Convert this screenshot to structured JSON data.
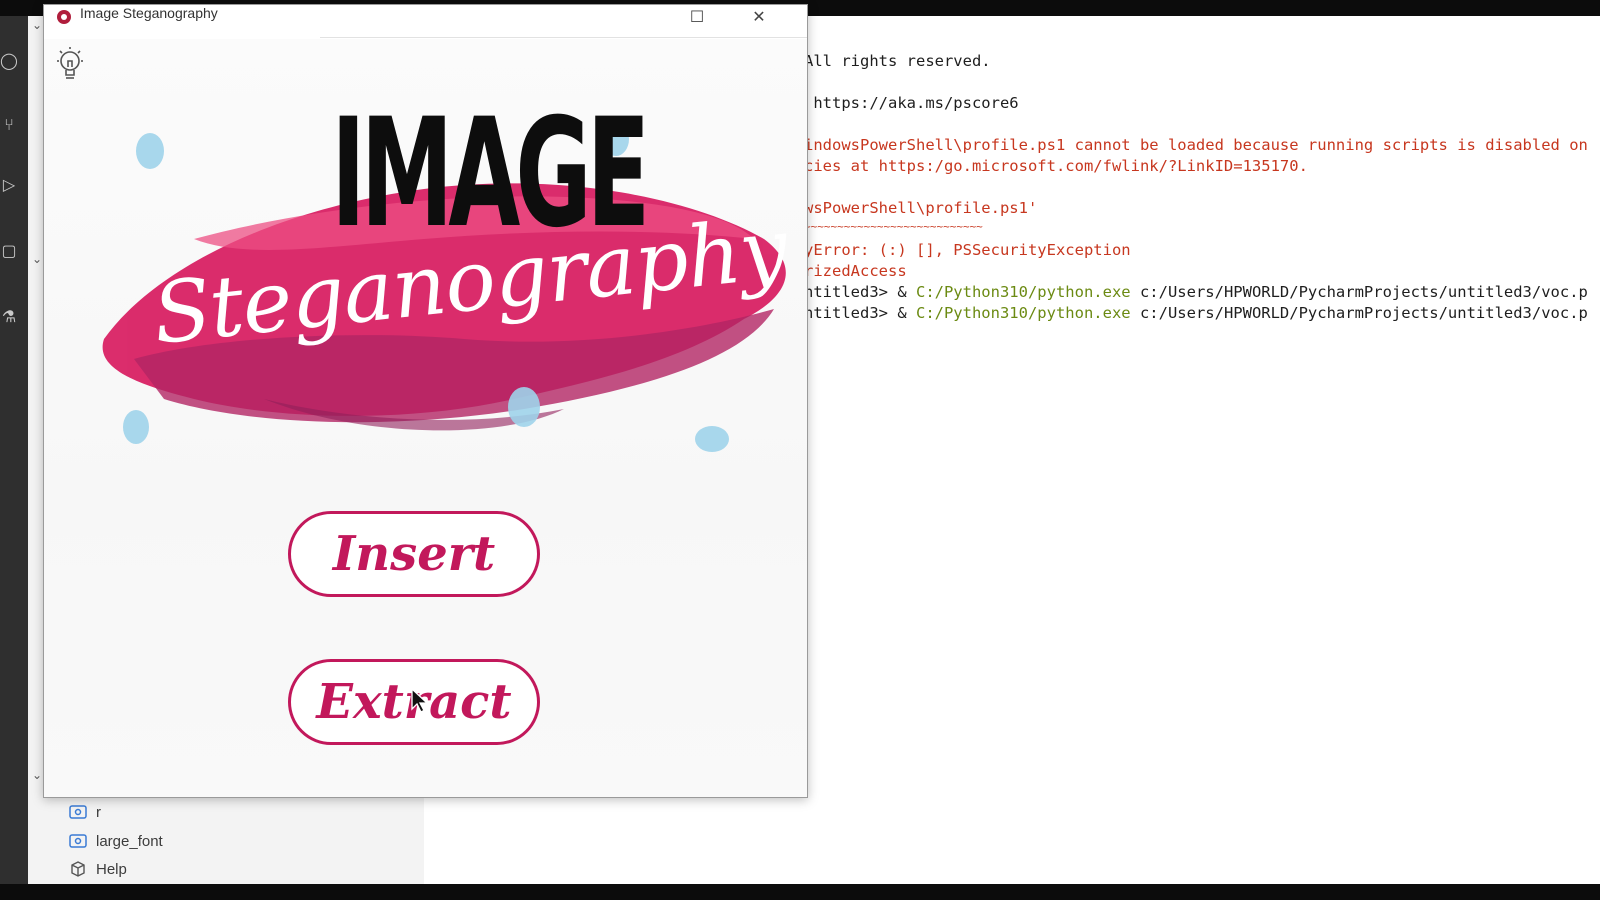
{
  "app_window": {
    "title": "Image Steganography",
    "titlebar_buttons": [
      "maximize",
      "close"
    ],
    "logo": {
      "word1": "IMAGE",
      "word2": "Steganography"
    },
    "buttons": {
      "insert_label": "Insert",
      "extract_label": "Extract"
    },
    "accent_color": "#c2185b"
  },
  "explorer": {
    "outline_items": [
      {
        "label": "r",
        "icon": "variable-icon"
      },
      {
        "label": "large_font",
        "icon": "variable-icon"
      },
      {
        "label": "Help",
        "icon": "class-icon"
      }
    ]
  },
  "terminal": {
    "lines": [
      {
        "text": "All rights reserved.",
        "color": "#1e1e1e"
      },
      {
        "text": " https://aka.ms/pscore6",
        "color": "#1e1e1e"
      },
      {
        "text": "indowsPowerShell\\profile.ps1 cannot be loaded because running scripts is disabled on",
        "color": "#c7371f"
      },
      {
        "text": "cies at https:/go.microsoft.com/fwlink/?LinkID=135170.",
        "color": "#c7371f"
      },
      {
        "text": "wsPowerShell\\profile.ps1'",
        "color": "#c7371f"
      },
      {
        "text": "~~~~~~~~~~~~~~~~~~~~~~~~~~~",
        "color": "#c7371f"
      },
      {
        "text": "yError: (:) [], PSSecurityException",
        "color": "#c7371f"
      },
      {
        "text": "rizedAccess",
        "color": "#c7371f"
      }
    ],
    "commands": [
      {
        "prefix": "ntitled3> & ",
        "exe": "C:/Python310/python.exe",
        "arg": " c:/Users/HPWORLD/PycharmProjects/untitled3/voc.p"
      },
      {
        "prefix": "ntitled3> & ",
        "exe": "C:/Python310/python.exe",
        "arg": " c:/Users/HPWORLD/PycharmProjects/untitled3/voc.p"
      }
    ]
  }
}
